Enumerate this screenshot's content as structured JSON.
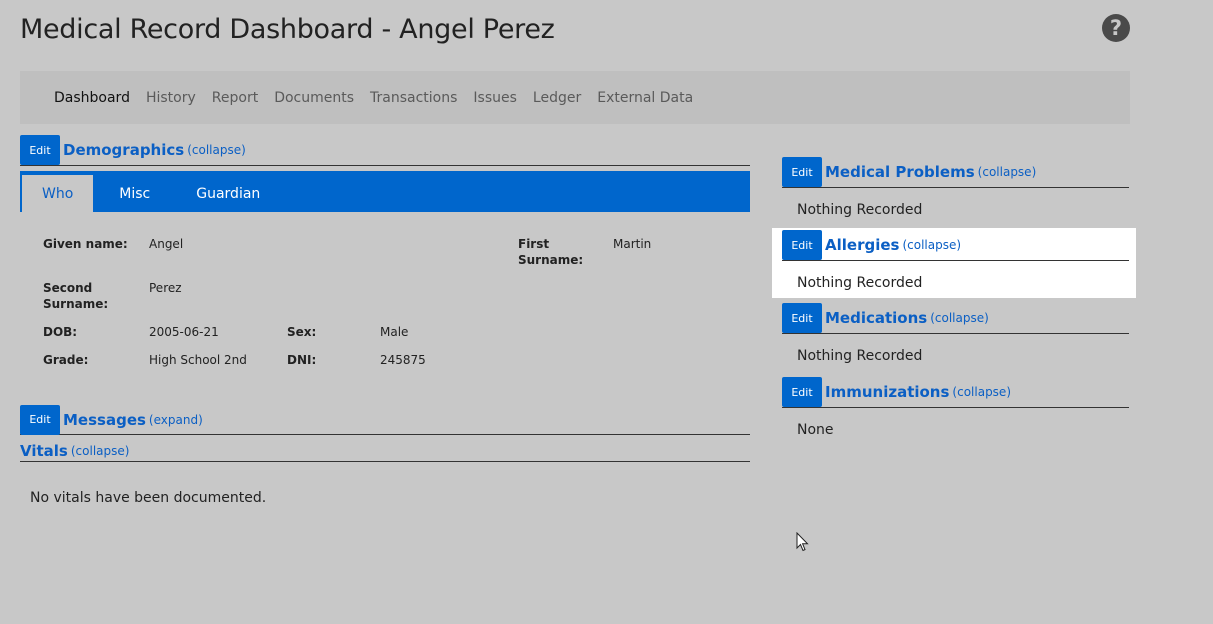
{
  "page": {
    "title": "Medical Record Dashboard - Angel Perez"
  },
  "help": {
    "icon": "question-circle-icon",
    "glyph": "?"
  },
  "nav": {
    "items": [
      {
        "label": "Dashboard",
        "active": true
      },
      {
        "label": "History"
      },
      {
        "label": "Report"
      },
      {
        "label": "Documents"
      },
      {
        "label": "Transactions"
      },
      {
        "label": "Issues"
      },
      {
        "label": "Ledger"
      },
      {
        "label": "External Data"
      }
    ]
  },
  "common": {
    "edit_label": "Edit",
    "collapse_label": "(collapse)",
    "expand_label": "(expand)"
  },
  "demographics": {
    "title": "Demographics",
    "tabs": [
      "Who",
      "Misc",
      "Guardian"
    ],
    "fields": {
      "given_name": {
        "label": "Given name:",
        "value": "Angel"
      },
      "first_surname": {
        "label_line1": "First",
        "label_line2": "Surname:",
        "value": "Martin"
      },
      "second_surname": {
        "label_line1": "Second",
        "label_line2": "Surname:",
        "value": "Perez"
      },
      "dob": {
        "label": "DOB:",
        "value": "2005-06-21"
      },
      "sex": {
        "label": "Sex:",
        "value": "Male"
      },
      "grade": {
        "label": "Grade:",
        "value": "High School 2nd"
      },
      "dni": {
        "label": "DNI:",
        "value": "245875"
      }
    }
  },
  "messages": {
    "title": "Messages"
  },
  "vitals": {
    "title": "Vitals",
    "empty_text": "No vitals have been documented."
  },
  "medical_problems": {
    "title": "Medical Problems",
    "content": "Nothing Recorded"
  },
  "allergies": {
    "title": "Allergies",
    "content": "Nothing Recorded"
  },
  "medications": {
    "title": "Medications",
    "content": "Nothing Recorded"
  },
  "immunizations": {
    "title": "Immunizations",
    "content": "None"
  },
  "colors": {
    "background": "#c8c8c8",
    "accent": "#0066cc",
    "link": "#0b5fc4",
    "highlight": "#ffffff"
  }
}
